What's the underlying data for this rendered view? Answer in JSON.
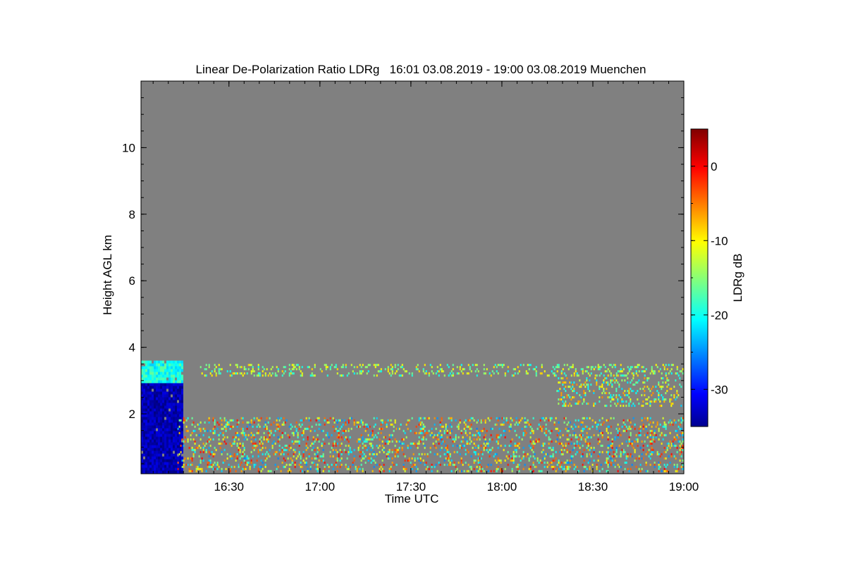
{
  "chart_data": {
    "type": "heatmap",
    "title": "Linear De-Polarization Ratio LDRg   16:01 03.08.2019 - 19:00 03.08.2019 Muenchen",
    "xlabel": "Time UTC",
    "ylabel": "Height AGL km",
    "x_range": [
      "16:01",
      "19:00"
    ],
    "y_range": [
      0.2,
      12.0
    ],
    "x_ticks": [
      "16:30",
      "17:00",
      "17:30",
      "18:00",
      "18:30",
      "19:00"
    ],
    "y_ticks": [
      "2",
      "4",
      "6",
      "8",
      "10"
    ],
    "colorbar": {
      "label": "LDRg dB",
      "range": [
        -35,
        5
      ],
      "ticks": [
        "0",
        "-10",
        "-20",
        "-30"
      ],
      "colormap": "jet"
    },
    "background_color": "#808080",
    "features": [
      {
        "description": "dense layer 16:01-16:15",
        "x_range": [
          "16:01",
          "16:15"
        ],
        "height_km": [
          0.2,
          3.6
        ],
        "ldr_db": [
          -35,
          -18
        ]
      },
      {
        "description": "boundary layer",
        "x_range": [
          "16:13",
          "19:00"
        ],
        "height_km": [
          0.2,
          1.9
        ],
        "ldr_db": [
          -25,
          0
        ]
      },
      {
        "description": "thin layer",
        "x_range": [
          "16:20",
          "19:00"
        ],
        "height_km": [
          3.1,
          3.5
        ],
        "ldr_db": [
          -20,
          -8
        ]
      },
      {
        "description": "layer",
        "x_range": [
          "18:18",
          "19:00"
        ],
        "height_km": [
          2.2,
          3.1
        ],
        "ldr_db": [
          -22,
          -5
        ]
      }
    ]
  }
}
